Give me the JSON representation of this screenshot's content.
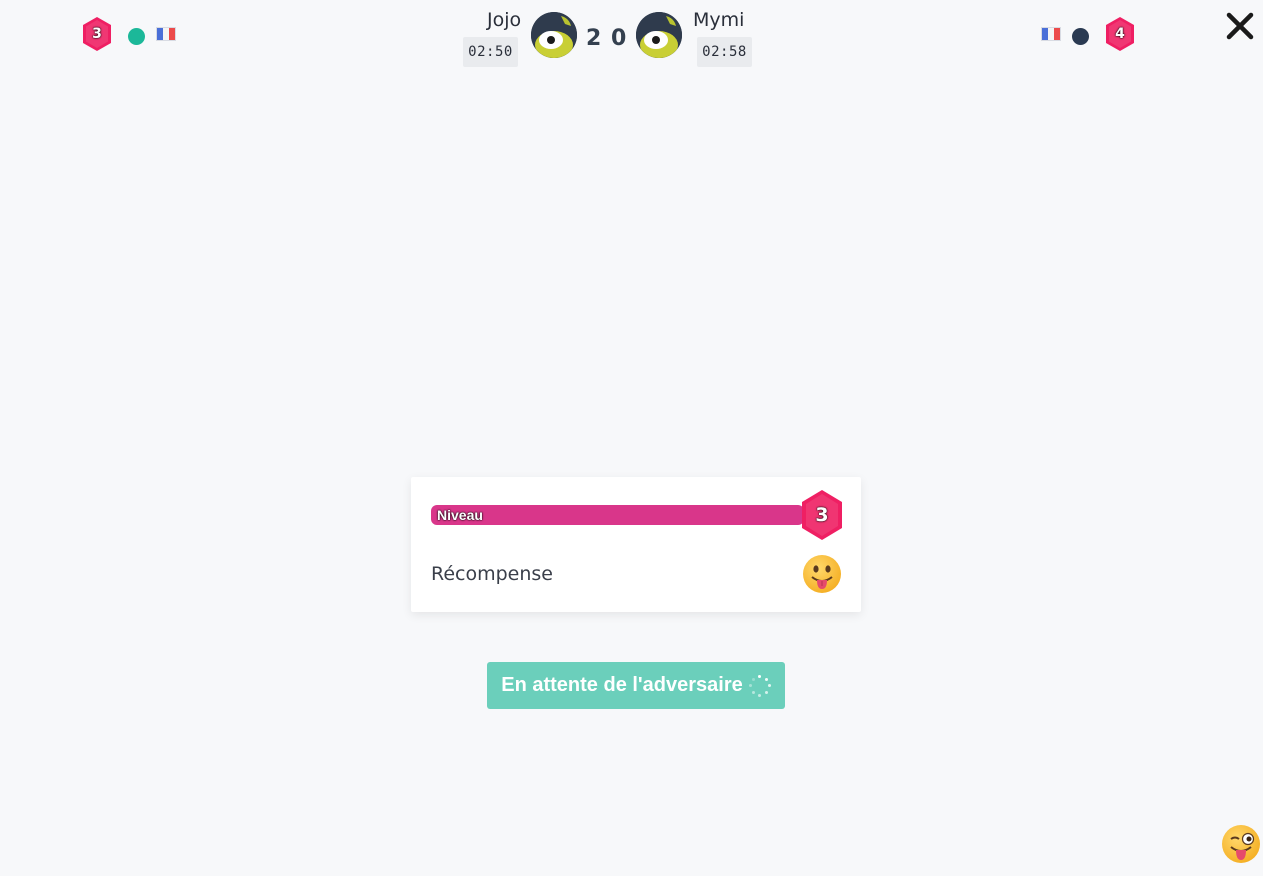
{
  "left_player": {
    "level": "3",
    "status_color": "#1cb899",
    "name": "Jojo",
    "timer": "02:50",
    "score": "2"
  },
  "right_player": {
    "level": "4",
    "status_color": "#2a3a52",
    "name": "Mymi",
    "timer": "02:58",
    "score": "0"
  },
  "close_icon": "close-icon",
  "result_card": {
    "level_label": "Niveau",
    "level_value": "3",
    "level_progress": 1.0,
    "reward_label": "Récompense",
    "reward_icon": "tongue-out-emoji-icon"
  },
  "waiting_button": {
    "label": "En attente de l'adversaire",
    "icon": "spinner-icon"
  },
  "emoji_picker_icon": "winking-tongue-emoji-icon",
  "colors": {
    "level_hex": "#e8195f",
    "level_bar": "#d9368a",
    "button": "#6bcfbb",
    "background": "#f7f8fa"
  }
}
